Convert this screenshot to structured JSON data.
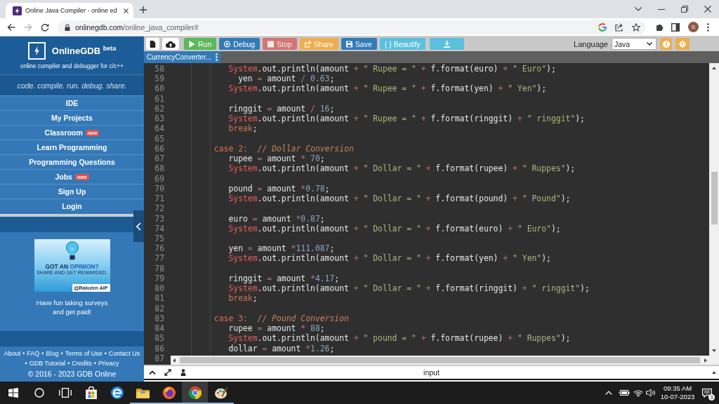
{
  "browser": {
    "tab_title": "Online Java Compiler - online ed",
    "url_host": "onlinegdb.com",
    "url_path": "/online_java_compiler#",
    "profile_initial": "S"
  },
  "sidebar": {
    "brand": "OnlineGDB $^{beta}$",
    "subtitle": "online compiler and debugger for c/c++",
    "tagline": "code. compile. run. debug. share.",
    "menu": [
      {
        "label": "IDE"
      },
      {
        "label": "My Projects"
      },
      {
        "label": "Classroom",
        "badge": "new"
      },
      {
        "label": "Learn Programming"
      },
      {
        "label": "Programming Questions"
      },
      {
        "label": "Jobs",
        "badge": "new"
      },
      {
        "label": "Sign Up"
      },
      {
        "label": "Login"
      }
    ],
    "ad": {
      "headline": "GOT AN",
      "headline_accent": "OPINION?",
      "subline": "SHARE AND GET REWARDED.",
      "brand": "Rakuten AIP",
      "caption": "Have fun taking surveys and get paid!"
    },
    "footer": {
      "links": [
        {
          "label": "About"
        },
        {
          "separator": "•",
          "label": "FAQ"
        },
        {
          "separator": "•",
          "label": "Blog"
        },
        {
          "separator": "•",
          "label": "Terms of Use"
        },
        {
          "separator": "•",
          "label": "Contact Us"
        },
        {
          "separator": "•",
          "label": "GDB Tutorial"
        },
        {
          "separator": "•",
          "label": "Credits"
        },
        {
          "separator": "•",
          "label": "Privacy"
        }
      ],
      "copyright": "© 2016 - 2023 GDB Online"
    }
  },
  "toolbar": {
    "buttons": [
      {
        "kind": "new",
        "disabled": false
      },
      {
        "kind": "upload",
        "disabled": false
      },
      {
        "kind": "run",
        "label": "Run",
        "disabled": false
      },
      {
        "kind": "debug",
        "label": "Debug",
        "disabled": false
      },
      {
        "kind": "stop",
        "label": "Stop",
        "disabled": true
      },
      {
        "kind": "share",
        "label": "Share",
        "disabled": false
      },
      {
        "kind": "save",
        "label": "Save",
        "disabled": false
      },
      {
        "kind": "beautify",
        "label": "{ } Beautify",
        "disabled": false
      },
      {
        "kind": "download",
        "disabled": false
      }
    ],
    "language_label": "Language",
    "language": "Java"
  },
  "file_tabs": [
    {
      "label": "CurrencyConverter...",
      "selected": true
    }
  ],
  "editor": {
    "lines": [
      {
        "number": "58",
        "tokens": [
          {
            "text": "           System",
            "kind": "type"
          },
          {
            "text": ".out.println(amount ",
            "kind": "plain"
          },
          {
            "text": "+",
            "kind": "op"
          },
          {
            "text": " \" Rupee = \"",
            "kind": "str"
          },
          {
            "text": " +",
            "kind": "op"
          },
          {
            "text": " f.format(euro) ",
            "kind": "plain"
          },
          {
            "text": "+",
            "kind": "op"
          },
          {
            "text": " \" Euro\"",
            "kind": "str"
          },
          {
            "text": ");",
            "kind": "plain"
          }
        ]
      },
      {
        "number": "59",
        "tokens": [
          {
            "text": "             yen ",
            "kind": "plain"
          },
          {
            "text": "=",
            "kind": "op"
          },
          {
            "text": " amount ",
            "kind": "plain"
          },
          {
            "text": "/",
            "kind": "op"
          },
          {
            "text": " 0.63",
            "kind": "num"
          },
          {
            "text": ";",
            "kind": "plain"
          }
        ]
      },
      {
        "number": "60",
        "tokens": [
          {
            "text": "           System",
            "kind": "type"
          },
          {
            "text": ".out.println(amount ",
            "kind": "plain"
          },
          {
            "text": "+",
            "kind": "op"
          },
          {
            "text": " \" Rupee = \"",
            "kind": "str"
          },
          {
            "text": " +",
            "kind": "op"
          },
          {
            "text": " f.format(yen) ",
            "kind": "plain"
          },
          {
            "text": "+",
            "kind": "op"
          },
          {
            "text": " \" Yen\"",
            "kind": "str"
          },
          {
            "text": ");",
            "kind": "plain"
          }
        ]
      },
      {
        "number": "61"
      },
      {
        "number": "62",
        "tokens": [
          {
            "text": "           ringgit ",
            "kind": "plain"
          },
          {
            "text": "=",
            "kind": "op"
          },
          {
            "text": " amount ",
            "kind": "plain"
          },
          {
            "text": "/",
            "kind": "op"
          },
          {
            "text": " 16",
            "kind": "num"
          },
          {
            "text": ";",
            "kind": "plain"
          }
        ]
      },
      {
        "number": "63",
        "tokens": [
          {
            "text": "           System",
            "kind": "type"
          },
          {
            "text": ".out.println(amount ",
            "kind": "plain"
          },
          {
            "text": "+",
            "kind": "op"
          },
          {
            "text": " \" Rupee = \"",
            "kind": "str"
          },
          {
            "text": " +",
            "kind": "op"
          },
          {
            "text": " f.format(ringgit) ",
            "kind": "plain"
          },
          {
            "text": "+",
            "kind": "op"
          },
          {
            "text": " \" ringgit\"",
            "kind": "str"
          },
          {
            "text": ");",
            "kind": "plain"
          }
        ]
      },
      {
        "number": "64",
        "tokens": [
          {
            "text": "           break",
            "kind": "kw"
          },
          {
            "text": ";",
            "kind": "plain"
          }
        ]
      },
      {
        "number": "65"
      },
      {
        "number": "66",
        "tokens": [
          {
            "text": "        case 2:",
            "kind": "kw"
          },
          {
            "text": "  // Dollar Conversion",
            "kind": "cmt"
          }
        ]
      },
      {
        "number": "67",
        "tokens": [
          {
            "text": "           rupee ",
            "kind": "plain"
          },
          {
            "text": "=",
            "kind": "op"
          },
          {
            "text": " amount ",
            "kind": "plain"
          },
          {
            "text": "*",
            "kind": "op"
          },
          {
            "text": " 70",
            "kind": "num"
          },
          {
            "text": ";",
            "kind": "plain"
          }
        ]
      },
      {
        "number": "68",
        "tokens": [
          {
            "text": "           System",
            "kind": "type"
          },
          {
            "text": ".out.println(amount ",
            "kind": "plain"
          },
          {
            "text": "+",
            "kind": "op"
          },
          {
            "text": " \" Dollar = \"",
            "kind": "str"
          },
          {
            "text": " +",
            "kind": "op"
          },
          {
            "text": " f.format(rupee) ",
            "kind": "plain"
          },
          {
            "text": "+",
            "kind": "op"
          },
          {
            "text": " \" Ruppes\"",
            "kind": "str"
          },
          {
            "text": ");",
            "kind": "plain"
          }
        ]
      },
      {
        "number": "69"
      },
      {
        "number": "70",
        "tokens": [
          {
            "text": "           pound ",
            "kind": "plain"
          },
          {
            "text": "=",
            "kind": "op"
          },
          {
            "text": " amount ",
            "kind": "plain"
          },
          {
            "text": "*",
            "kind": "op"
          },
          {
            "text": "0.78",
            "kind": "num"
          },
          {
            "text": ";",
            "kind": "plain"
          }
        ]
      },
      {
        "number": "71",
        "tokens": [
          {
            "text": "           System",
            "kind": "type"
          },
          {
            "text": ".out.println(amount ",
            "kind": "plain"
          },
          {
            "text": "+",
            "kind": "op"
          },
          {
            "text": " \" Dollar = \"",
            "kind": "str"
          },
          {
            "text": " +",
            "kind": "op"
          },
          {
            "text": " f.format(pound) ",
            "kind": "plain"
          },
          {
            "text": "+",
            "kind": "op"
          },
          {
            "text": " \" Pound\"",
            "kind": "str"
          },
          {
            "text": ");",
            "kind": "plain"
          }
        ]
      },
      {
        "number": "72"
      },
      {
        "number": "73",
        "tokens": [
          {
            "text": "           euro ",
            "kind": "plain"
          },
          {
            "text": "=",
            "kind": "op"
          },
          {
            "text": " amount ",
            "kind": "plain"
          },
          {
            "text": "*",
            "kind": "op"
          },
          {
            "text": "0.87",
            "kind": "num"
          },
          {
            "text": ";",
            "kind": "plain"
          }
        ]
      },
      {
        "number": "74",
        "tokens": [
          {
            "text": "           System",
            "kind": "type"
          },
          {
            "text": ".out.println(amount ",
            "kind": "plain"
          },
          {
            "text": "+",
            "kind": "op"
          },
          {
            "text": " \" Dollar = \"",
            "kind": "str"
          },
          {
            "text": " +",
            "kind": "op"
          },
          {
            "text": " f.format(euro) ",
            "kind": "plain"
          },
          {
            "text": "+",
            "kind": "op"
          },
          {
            "text": " \" Euro\"",
            "kind": "str"
          },
          {
            "text": ");",
            "kind": "plain"
          }
        ]
      },
      {
        "number": "75"
      },
      {
        "number": "76",
        "tokens": [
          {
            "text": "           yen ",
            "kind": "plain"
          },
          {
            "text": "=",
            "kind": "op"
          },
          {
            "text": " amount ",
            "kind": "plain"
          },
          {
            "text": "*",
            "kind": "op"
          },
          {
            "text": "111.087",
            "kind": "num"
          },
          {
            "text": ";",
            "kind": "plain"
          }
        ]
      },
      {
        "number": "77",
        "tokens": [
          {
            "text": "           System",
            "kind": "type"
          },
          {
            "text": ".out.println(amount ",
            "kind": "plain"
          },
          {
            "text": "+",
            "kind": "op"
          },
          {
            "text": " \" Dollar = \"",
            "kind": "str"
          },
          {
            "text": " +",
            "kind": "op"
          },
          {
            "text": " f.format(yen) ",
            "kind": "plain"
          },
          {
            "text": "+",
            "kind": "op"
          },
          {
            "text": " \" Yen\"",
            "kind": "str"
          },
          {
            "text": ");",
            "kind": "plain"
          }
        ]
      },
      {
        "number": "78"
      },
      {
        "number": "79",
        "tokens": [
          {
            "text": "           ringgit ",
            "kind": "plain"
          },
          {
            "text": "=",
            "kind": "op"
          },
          {
            "text": " amount ",
            "kind": "plain"
          },
          {
            "text": "*",
            "kind": "op"
          },
          {
            "text": "4.17",
            "kind": "num"
          },
          {
            "text": ";",
            "kind": "plain"
          }
        ]
      },
      {
        "number": "80",
        "tokens": [
          {
            "text": "           System",
            "kind": "type"
          },
          {
            "text": ".out.println(amount ",
            "kind": "plain"
          },
          {
            "text": "+",
            "kind": "op"
          },
          {
            "text": " \" Dollar = \"",
            "kind": "str"
          },
          {
            "text": " +",
            "kind": "op"
          },
          {
            "text": " f.format(ringgit) ",
            "kind": "plain"
          },
          {
            "text": "+",
            "kind": "op"
          },
          {
            "text": " \" ringgit\"",
            "kind": "str"
          },
          {
            "text": ");",
            "kind": "plain"
          }
        ]
      },
      {
        "number": "81",
        "tokens": [
          {
            "text": "           break",
            "kind": "kw"
          },
          {
            "text": ";",
            "kind": "plain"
          }
        ]
      },
      {
        "number": "82"
      },
      {
        "number": "83",
        "tokens": [
          {
            "text": "        case 3:",
            "kind": "kw"
          },
          {
            "text": "  // Pound Conversion",
            "kind": "cmt"
          }
        ]
      },
      {
        "number": "84",
        "tokens": [
          {
            "text": "           rupee ",
            "kind": "plain"
          },
          {
            "text": "=",
            "kind": "op"
          },
          {
            "text": " amount ",
            "kind": "plain"
          },
          {
            "text": "*",
            "kind": "op"
          },
          {
            "text": " 88",
            "kind": "num"
          },
          {
            "text": ";",
            "kind": "plain"
          }
        ]
      },
      {
        "number": "85",
        "tokens": [
          {
            "text": "           System",
            "kind": "type"
          },
          {
            "text": ".out.println(amount ",
            "kind": "plain"
          },
          {
            "text": "+",
            "kind": "op"
          },
          {
            "text": " \" pound = \"",
            "kind": "str"
          },
          {
            "text": " +",
            "kind": "op"
          },
          {
            "text": " f.format(rupee) ",
            "kind": "plain"
          },
          {
            "text": "+",
            "kind": "op"
          },
          {
            "text": " \" Ruppes\"",
            "kind": "str"
          },
          {
            "text": ");",
            "kind": "plain"
          }
        ]
      },
      {
        "number": "86",
        "tokens": [
          {
            "text": "           dollar ",
            "kind": "plain"
          },
          {
            "text": "=",
            "kind": "op"
          },
          {
            "text": " amount ",
            "kind": "plain"
          },
          {
            "text": "*",
            "kind": "op"
          },
          {
            "text": "1.26",
            "kind": "num"
          },
          {
            "text": ";",
            "kind": "plain"
          }
        ]
      },
      {
        "number": "87"
      }
    ]
  },
  "output_pane": {
    "title": "input"
  },
  "taskbar": {
    "apps": [
      {
        "kind": "start",
        "running": false,
        "selected": false
      },
      {
        "kind": "search",
        "running": false,
        "selected": false
      },
      {
        "kind": "task-view",
        "running": false,
        "selected": false
      },
      {
        "kind": "store",
        "running": false,
        "selected": false
      },
      {
        "kind": "edge",
        "running": false,
        "selected": false
      },
      {
        "kind": "explorer",
        "running": true,
        "selected": false
      },
      {
        "kind": "firefox",
        "running": true,
        "selected": false
      },
      {
        "kind": "chrome",
        "running": true,
        "selected": true
      },
      {
        "kind": "paint",
        "running": true,
        "selected": false
      }
    ],
    "time": "09:35 AM",
    "date": "10-07-2023",
    "notifications": "3"
  }
}
